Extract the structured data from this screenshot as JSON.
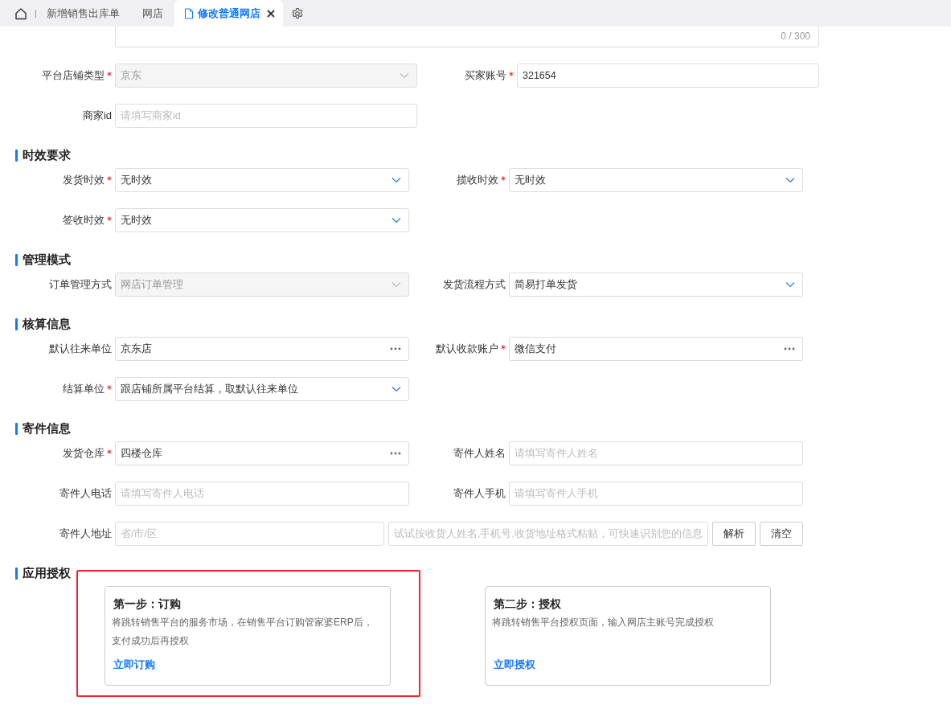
{
  "tabs": [
    {
      "label": "新增销售出库单",
      "selected": false,
      "closable": false
    },
    {
      "label": "网店",
      "selected": false,
      "closable": false
    },
    {
      "label": "修改普通网店",
      "selected": true,
      "closable": true
    }
  ],
  "form": {
    "top_rows": [
      {
        "fields": [
          {
            "kind": "textarea",
            "counter": "0 / 300"
          }
        ]
      },
      {
        "fields": [
          {
            "kind": "select",
            "label": "平台店铺类型",
            "required": true,
            "value": "京东",
            "disabled": true
          },
          {
            "kind": "input",
            "label": "买家账号",
            "required": true,
            "value": "321654",
            "disabled": false
          }
        ]
      },
      {
        "fields": [
          {
            "kind": "input",
            "label": "商家id",
            "required": false,
            "placeholder": "请填写商家id"
          }
        ]
      }
    ],
    "sections": [
      {
        "title": "时效要求",
        "rows": [
          {
            "fields": [
              {
                "kind": "select",
                "label": "发货时效",
                "required": true,
                "value": "无时效",
                "disabled": false
              },
              {
                "kind": "select",
                "label": "揽收时效",
                "required": true,
                "value": "无时效",
                "disabled": false
              }
            ]
          },
          {
            "fields": [
              {
                "kind": "select",
                "label": "签收时效",
                "required": true,
                "value": "无时效",
                "disabled": false
              }
            ]
          }
        ]
      },
      {
        "title": "管理模式",
        "rows": [
          {
            "fields": [
              {
                "kind": "select",
                "label": "订单管理方式",
                "required": false,
                "value": "网店订单管理",
                "disabled": true
              },
              {
                "kind": "select",
                "label": "发货流程方式",
                "required": false,
                "value": "简易打单发货",
                "disabled": false
              }
            ]
          }
        ]
      },
      {
        "title": "核算信息",
        "rows": [
          {
            "fields": [
              {
                "kind": "lookup",
                "label": "默认往来单位",
                "required": false,
                "value": "京东店",
                "disabled": false
              },
              {
                "kind": "lookup",
                "label": "默认收款账户",
                "required": true,
                "value": "微信支付",
                "disabled": false
              }
            ]
          },
          {
            "fields": [
              {
                "kind": "select",
                "label": "结算单位",
                "required": true,
                "value": "跟店铺所属平台结算，取默认往来单位",
                "disabled": false
              }
            ]
          }
        ]
      },
      {
        "title": "寄件信息",
        "rows": [
          {
            "fields": [
              {
                "kind": "lookup",
                "label": "发货仓库",
                "required": true,
                "value": "四楼仓库",
                "disabled": false
              },
              {
                "kind": "input",
                "label": "寄件人姓名",
                "required": false,
                "placeholder": "请填写寄件人姓名"
              }
            ]
          },
          {
            "fields": [
              {
                "kind": "input",
                "label": "寄件人电话",
                "required": false,
                "placeholder": "请填写寄件人电话"
              },
              {
                "kind": "input",
                "label": "寄件人手机",
                "required": false,
                "placeholder": "请填写寄件人手机"
              }
            ]
          },
          {
            "address": {
              "label": "寄件人地址",
              "region_placeholder": "省/市/区",
              "paste_placeholder": "试试按收货人姓名,手机号,收货地址格式粘贴，可快速识别您的信息",
              "buttons": [
                "解析",
                "清空"
              ]
            }
          }
        ]
      },
      {
        "title": "应用授权",
        "cards": [
          {
            "title": "第一步：订购",
            "description": "将跳转销售平台的服务市场，在销售平台订购管家婆ERP后，支付成功后再授权",
            "link": "立即订购",
            "highlighted": true
          },
          {
            "title": "第二步：授权",
            "description": "将跳转销售平台授权页面，输入网店主账号完成授权",
            "link": "立即授权",
            "highlighted": false
          }
        ]
      }
    ]
  }
}
